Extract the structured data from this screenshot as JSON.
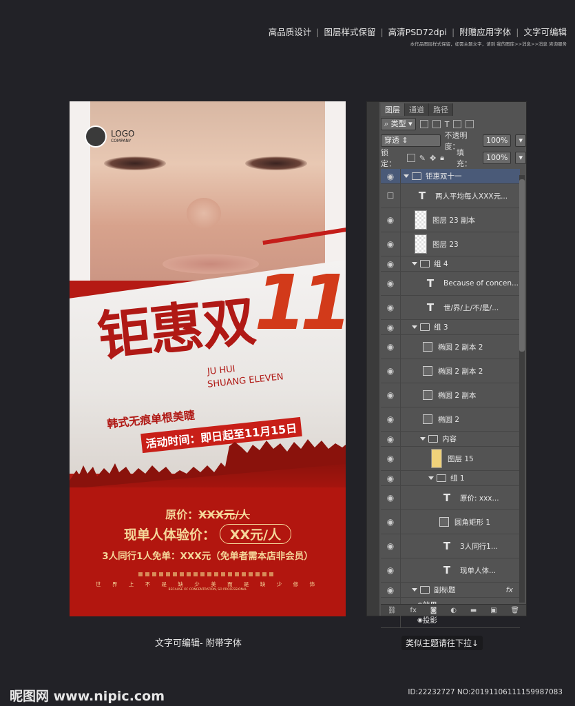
{
  "header": {
    "features": [
      "高品质设计",
      "图层样式保留",
      "高清PSD72dpi",
      "附赠应用字体",
      "文字可编辑"
    ],
    "note": "本作品图层样式保留，如需主题文字，请到 我的图库>>消息>>消息 咨询服务"
  },
  "poster": {
    "logo_main": "LOGO",
    "logo_sub": "COMPANY",
    "title": "钜惠双",
    "title_number": "11",
    "subtitle_line1": "JU HUI",
    "subtitle_line2": "SHUANG ELEVEN",
    "slogan1": "韩式无痕单根美睫",
    "slogan2": "活动时间：即日起至11月15日",
    "price_label": "原价：",
    "price_old": "XXX元/人",
    "price_now_label": "现单人体验价：",
    "price_now": "XX元/人",
    "group_offer": "3人同行1人免单：XXX元（免单者需本店非会员）",
    "ticker": "世 界 上 不 是 缺 少 美 而 是 缺 少 修 饰",
    "ticker_en": "BECAUSE OF CONCENTRATION, SO PROFESSIONAL"
  },
  "panel": {
    "tabs": [
      "图层",
      "通道",
      "路径"
    ],
    "filter_label": "类型",
    "blend_mode": "穿透",
    "opacity_label": "不透明度：",
    "opacity_value": "100%",
    "lock_label": "锁定：",
    "fill_label": "填充：",
    "fill_value": "100%",
    "layers": [
      {
        "type": "group",
        "name": "钜惠双十一",
        "indent": 0
      },
      {
        "type": "text",
        "name": "两人平均每人XXX元...",
        "indent": 1
      },
      {
        "type": "raster",
        "name": "图层 23 副本",
        "indent": 1
      },
      {
        "type": "raster",
        "name": "图层 23",
        "indent": 1
      },
      {
        "type": "group",
        "name": "组 4",
        "indent": 1
      },
      {
        "type": "text",
        "name": "Because of concen...",
        "indent": 2
      },
      {
        "type": "text",
        "name": "世/界/上/不/是/...",
        "indent": 2
      },
      {
        "type": "group",
        "name": "组 3",
        "indent": 1
      },
      {
        "type": "shape",
        "name": "椭圆 2 副本 2",
        "indent": 2
      },
      {
        "type": "shape",
        "name": "椭圆 2 副本 2",
        "indent": 2
      },
      {
        "type": "shape",
        "name": "椭圆 2 副本",
        "indent": 2
      },
      {
        "type": "shape",
        "name": "椭圆 2",
        "indent": 2
      },
      {
        "type": "group",
        "name": "内容",
        "indent": 2
      },
      {
        "type": "gold",
        "name": "图层 15",
        "indent": 3
      },
      {
        "type": "group",
        "name": "组 1",
        "indent": 3
      },
      {
        "type": "text",
        "name": "原价: xxx...",
        "indent": 4
      },
      {
        "type": "shape",
        "name": "圆角矩形 1",
        "indent": 4
      },
      {
        "type": "text",
        "name": "3人同行1...",
        "indent": 4
      },
      {
        "type": "text",
        "name": "现单人体...",
        "indent": 4
      },
      {
        "type": "group",
        "name": "副标题",
        "indent": 1
      },
      {
        "type": "effect",
        "name": "效果",
        "indent": 2
      },
      {
        "type": "effect",
        "name": "投影",
        "indent": 2
      }
    ],
    "fx_label": "fx"
  },
  "footer": {
    "caption": "文字可编辑- 附带字体",
    "pull_hint": "类似主题请往下拉↓",
    "site": "昵图网 www.nipic.com",
    "id_text": "ID:22232727 NO:20191106111159987083"
  },
  "colors": {
    "poster_red": "#b2160f",
    "gold": "#f5d79a",
    "panel_bg": "#535353"
  }
}
